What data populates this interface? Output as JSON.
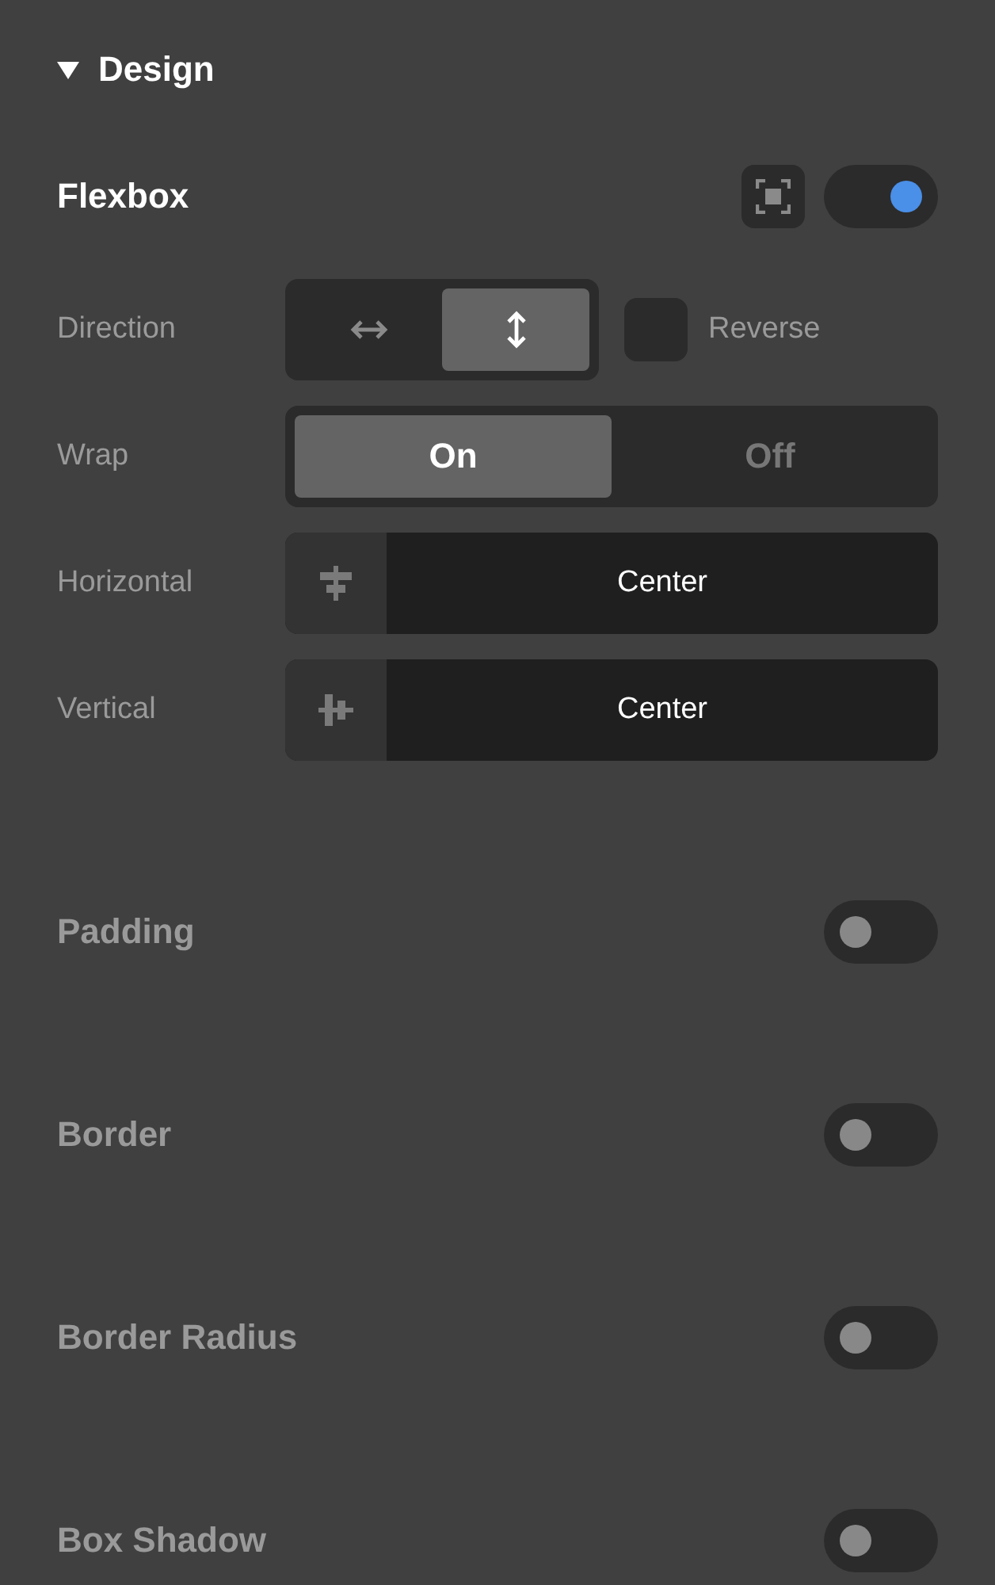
{
  "header": {
    "title": "Design",
    "expanded": true
  },
  "flexbox": {
    "title": "Flexbox",
    "on": true,
    "direction": {
      "label": "Direction",
      "options": [
        {
          "kind": "horizontal",
          "selected": false
        },
        {
          "kind": "vertical",
          "selected": true
        }
      ],
      "reverse": {
        "label": "Reverse",
        "checked": false
      }
    },
    "wrap": {
      "label": "Wrap",
      "options": [
        {
          "label": "On",
          "selected": true
        },
        {
          "label": "Off",
          "selected": false
        }
      ]
    },
    "align": [
      {
        "label": "Horizontal",
        "kind": "horizontal",
        "value": "Center"
      },
      {
        "label": "Vertical",
        "kind": "vertical",
        "value": "Center"
      }
    ]
  },
  "sections": [
    {
      "label": "Padding",
      "on": false
    },
    {
      "label": "Border",
      "on": false
    },
    {
      "label": "Border Radius",
      "on": false
    },
    {
      "label": "Box Shadow",
      "on": false
    }
  ]
}
